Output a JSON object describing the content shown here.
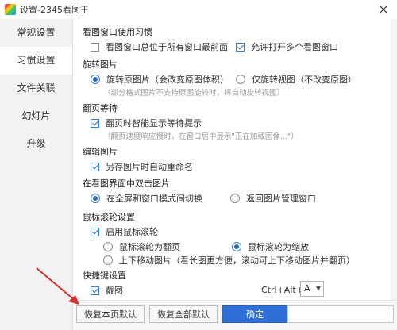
{
  "window": {
    "title": "设置-2345看图王",
    "close_glyph": "×"
  },
  "sidebar": {
    "items": [
      {
        "label": "常规设置",
        "active": false
      },
      {
        "label": "习惯设置",
        "active": true
      },
      {
        "label": "文件关联",
        "active": false
      },
      {
        "label": "幻灯片",
        "active": false
      },
      {
        "label": "升级",
        "active": false
      }
    ]
  },
  "sections": {
    "view_window": {
      "title": "看图窗口使用习惯",
      "always_top": {
        "label": "看图窗口总位于所有窗口最前面",
        "checked": false
      },
      "multi_window": {
        "label": "允许打开多个看图窗口",
        "checked": true
      }
    },
    "rotate": {
      "title": "旋转图片",
      "rotate_original": {
        "label": "旋转原图片（会改变原图体积）",
        "checked": true
      },
      "rotate_view": {
        "label": "仅旋转视图（不改变原图）",
        "checked": false
      },
      "note": "（部分格式图片不支持原图旋转时，将自动旋转视图）"
    },
    "page_wait": {
      "title": "翻页等待",
      "smart_wait": {
        "label": "翻页时智能显示等待提示",
        "checked": true
      },
      "note": "（翻页速度响应慢时，在窗口居中显示\"正在加载图像...\"）"
    },
    "edit_image": {
      "title": "编辑图片",
      "auto_rename": {
        "label": "另存图片时自动重命名",
        "checked": true
      }
    },
    "double_click": {
      "title": "在看图界面中双击图片",
      "toggle_fullscreen": {
        "label": "在全屏和窗口模式间切换",
        "checked": true
      },
      "return_manager": {
        "label": "返回图片管理窗口",
        "checked": false
      }
    },
    "wheel": {
      "title": "鼠标滚轮设置",
      "enable_wheel": {
        "label": "启用鼠标滚轮",
        "checked": true
      },
      "wheel_page": {
        "label": "鼠标滚轮为翻页",
        "checked": false
      },
      "wheel_zoom": {
        "label": "鼠标滚轮为缩放",
        "checked": true
      },
      "move_updown": {
        "label": "上下移动图片（看长图更方便，滚动可上下移动图片并翻页）",
        "checked": false
      }
    },
    "hotkey": {
      "title": "快捷键设置",
      "screenshot": {
        "label": "截图",
        "checked": true
      },
      "combo": "Ctrl+Alt+",
      "key": "A"
    }
  },
  "footer": {
    "restore_page": "恢复本页默认",
    "restore_all": "恢复全部默认",
    "confirm": "确定"
  },
  "colors": {
    "accent": "#2f6fd6",
    "sidebar_bg": "#f2f2f2",
    "annotation_arrow": "#d9322c"
  }
}
